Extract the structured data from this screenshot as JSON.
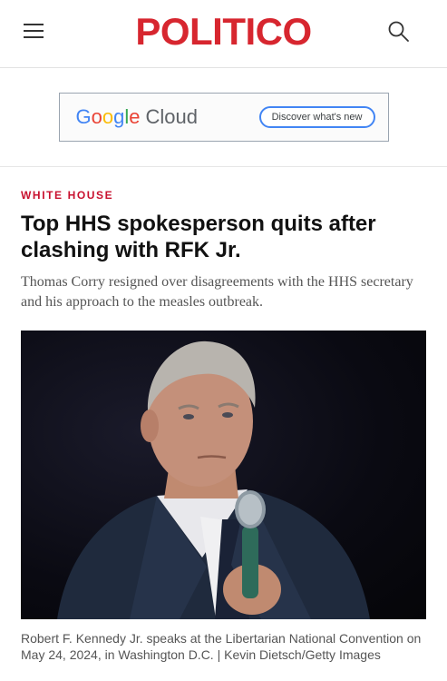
{
  "header": {
    "logo_text": "POLITICO",
    "menu_icon": "hamburger-menu-icon",
    "search_icon": "search-icon",
    "brand_color": "#d7262f"
  },
  "ad": {
    "brand_google": [
      "G",
      "o",
      "o",
      "g",
      "l",
      "e"
    ],
    "brand_product": "Cloud",
    "cta_label": "Discover what's new"
  },
  "article": {
    "section": "WHITE HOUSE",
    "headline": "Top HHS spokesperson quits after clashing with RFK Jr.",
    "dek": "Thomas Corry resigned over disagreements with the HHS secretary and his approach to the measles outbreak.",
    "caption": "Robert F. Kennedy Jr. speaks at the Libertarian National Convention on May 24, 2024, in Washington D.C. | Kevin Dietsch/Getty Images"
  }
}
